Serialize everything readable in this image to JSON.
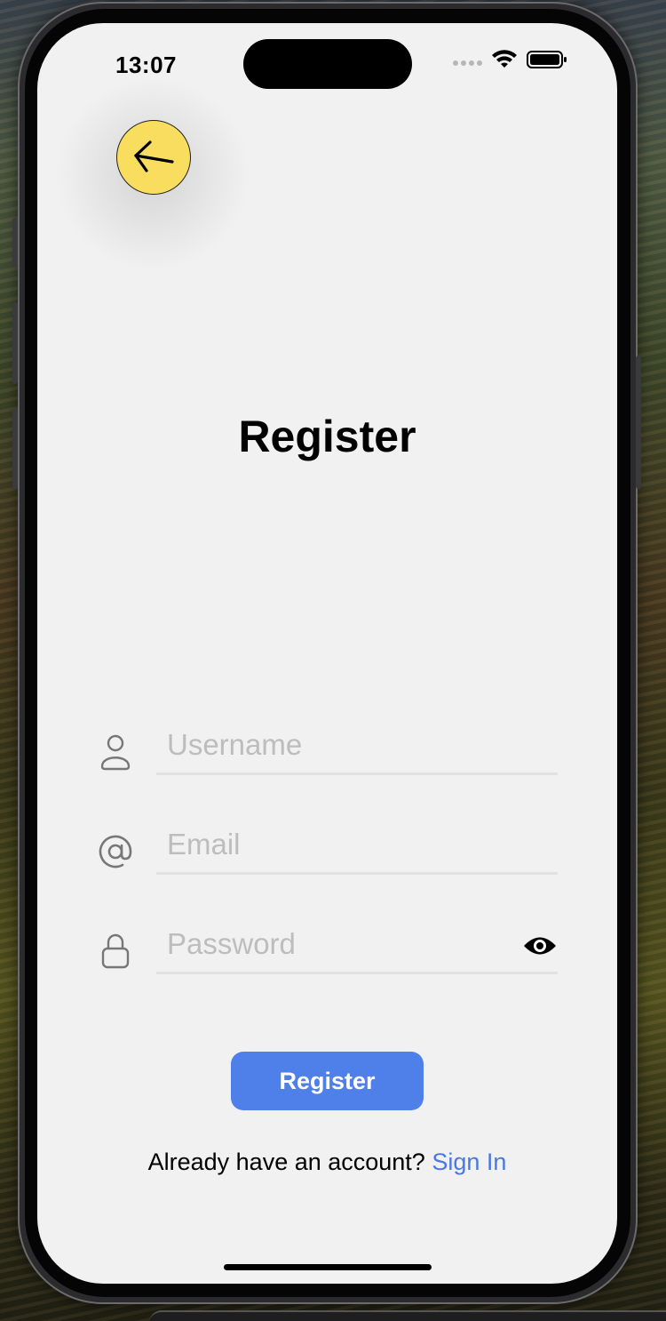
{
  "status_bar": {
    "time": "13:07",
    "wifi_icon": "wifi-icon",
    "battery_icon": "battery-icon",
    "signal_icon": "cellular-signal-icon"
  },
  "header": {
    "back_icon": "arrow-left-icon",
    "back_color": "#f9dd5e"
  },
  "main": {
    "title": "Register"
  },
  "form": {
    "username": {
      "icon": "person-icon",
      "placeholder": "Username",
      "value": ""
    },
    "email": {
      "icon": "at-sign-icon",
      "placeholder": "Email",
      "value": ""
    },
    "password": {
      "icon": "lock-icon",
      "placeholder": "Password",
      "value": "",
      "toggle_icon": "eye-icon"
    },
    "submit_label": "Register",
    "submit_color": "#4f7fe8"
  },
  "footer": {
    "prompt": "Already have an account?",
    "link_label": "Sign In",
    "link_color": "#4a78e2"
  }
}
